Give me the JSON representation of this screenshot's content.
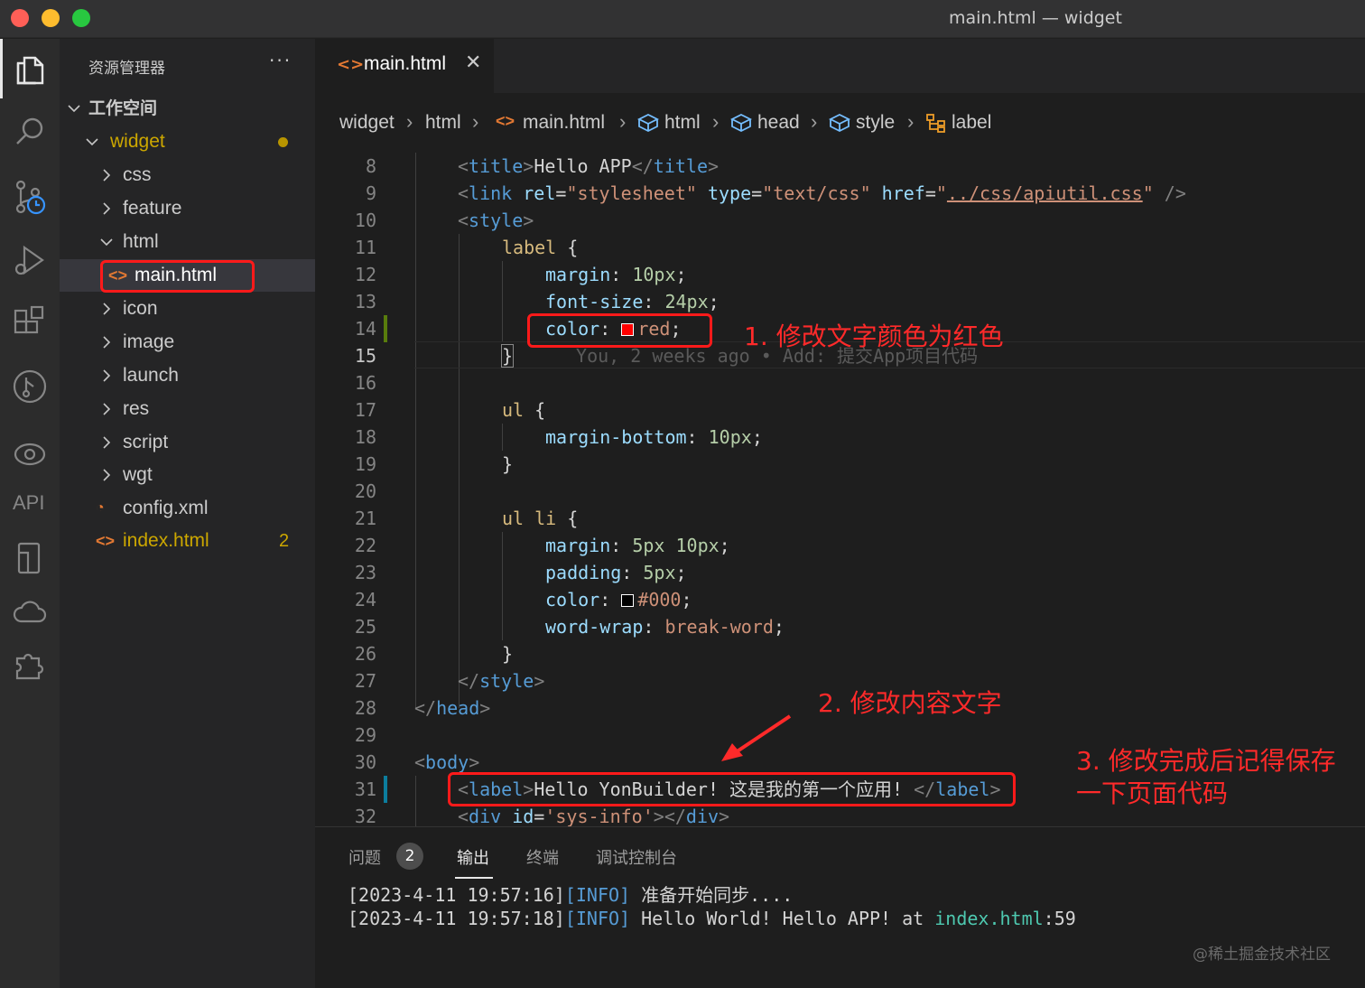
{
  "window": {
    "title": "main.html — widget"
  },
  "activity_bar": {
    "items": [
      "explorer-icon",
      "search-icon",
      "source-control-icon",
      "run-debug-icon",
      "extensions-icon",
      "git-graph-icon",
      "preview-icon",
      "api-icon",
      "mobile-device-icon",
      "cloud-icon",
      "plugin-icon"
    ],
    "api_label": "API"
  },
  "sidebar": {
    "header": "资源管理器",
    "more": "···",
    "workspace": "工作空间",
    "tree": [
      {
        "label": "widget",
        "type": "folder",
        "expanded": true
      },
      {
        "label": "css",
        "type": "folder"
      },
      {
        "label": "feature",
        "type": "folder"
      },
      {
        "label": "html",
        "type": "folder",
        "expanded": true
      },
      {
        "label": "main.html",
        "type": "file"
      },
      {
        "label": "icon",
        "type": "folder"
      },
      {
        "label": "image",
        "type": "folder"
      },
      {
        "label": "launch",
        "type": "folder"
      },
      {
        "label": "res",
        "type": "folder"
      },
      {
        "label": "script",
        "type": "folder"
      },
      {
        "label": "wgt",
        "type": "folder"
      },
      {
        "label": "config.xml",
        "type": "file"
      },
      {
        "label": "index.html",
        "type": "file",
        "badge": "2"
      }
    ]
  },
  "tab": {
    "label": "main.html",
    "close": "✕"
  },
  "breadcrumb": [
    "widget",
    "html",
    "main.html",
    "html",
    "head",
    "style",
    "label"
  ],
  "editor": {
    "line_numbers": [
      "8",
      "9",
      "10",
      "11",
      "12",
      "13",
      "14",
      "15",
      "16",
      "17",
      "18",
      "19",
      "20",
      "21",
      "22",
      "23",
      "24",
      "25",
      "26",
      "27",
      "28",
      "29",
      "30",
      "31",
      "32"
    ],
    "code": {
      "l8": [
        "<",
        "title",
        ">",
        "Hello APP",
        "</",
        "title",
        ">"
      ],
      "l9": [
        "<",
        "link",
        " rel",
        "=",
        "\"stylesheet\"",
        " type",
        "=",
        "\"text/css\"",
        " href",
        "=",
        "\"",
        "../css/apiutil.css",
        "\"",
        " />"
      ],
      "l10": [
        "<",
        "style",
        ">"
      ],
      "l11": [
        "label",
        " {"
      ],
      "l12": [
        "margin",
        ": ",
        "10px",
        ";"
      ],
      "l13": [
        "font-size",
        ": ",
        "24px",
        ";"
      ],
      "l14": [
        "color",
        ": ",
        "red",
        ";"
      ],
      "l15": [
        "}",
        "You, 2 weeks ago • Add: 提交App项目代码"
      ],
      "l17": [
        "ul",
        " {"
      ],
      "l18": [
        "margin-bottom",
        ": ",
        "10px",
        ";"
      ],
      "l19": [
        "}"
      ],
      "l21": [
        "ul li",
        " {"
      ],
      "l22": [
        "margin",
        ": ",
        "5px 10px",
        ";"
      ],
      "l23": [
        "padding",
        ": ",
        "5px",
        ";"
      ],
      "l24": [
        "color",
        ": ",
        "#000",
        ";"
      ],
      "l25": [
        "word-wrap",
        ": ",
        "break-word",
        ";"
      ],
      "l26": [
        "}"
      ],
      "l27": [
        "</",
        "style",
        ">"
      ],
      "l28": [
        "</",
        "head",
        ">"
      ],
      "l30": [
        "<",
        "body",
        ">"
      ],
      "l31": [
        "<",
        "label",
        ">",
        "Hello YonBuilder! 这是我的第一个应用! ",
        "</",
        "label",
        ">"
      ],
      "l32": [
        "<",
        "div",
        " id",
        "=",
        "'sys-info'",
        ">",
        "</",
        "div",
        ">"
      ]
    },
    "colors": {
      "swatch_red": "#ff0000",
      "swatch_black": "#000000"
    }
  },
  "annotations": {
    "a1": "1. 修改文字颜色为红色",
    "a2": "2. 修改内容文字",
    "a3_line1": "3. 修改完成后记得保存",
    "a3_line2": "一下页面代码"
  },
  "panel": {
    "tabs": [
      "问题",
      "输出",
      "终端",
      "调试控制台"
    ],
    "problems_count": "2",
    "log": [
      {
        "time": "[2023-4-11 19:57:16]",
        "level": "[INFO]",
        "msg": " 准备开始同步...."
      },
      {
        "time": "[2023-4-11 19:57:18]",
        "level": "[INFO]",
        "msg": " Hello World! Hello APP! at ",
        "link": "index.html",
        "suffix": ":59"
      }
    ],
    "watermark": "@稀土掘金技术社区"
  }
}
